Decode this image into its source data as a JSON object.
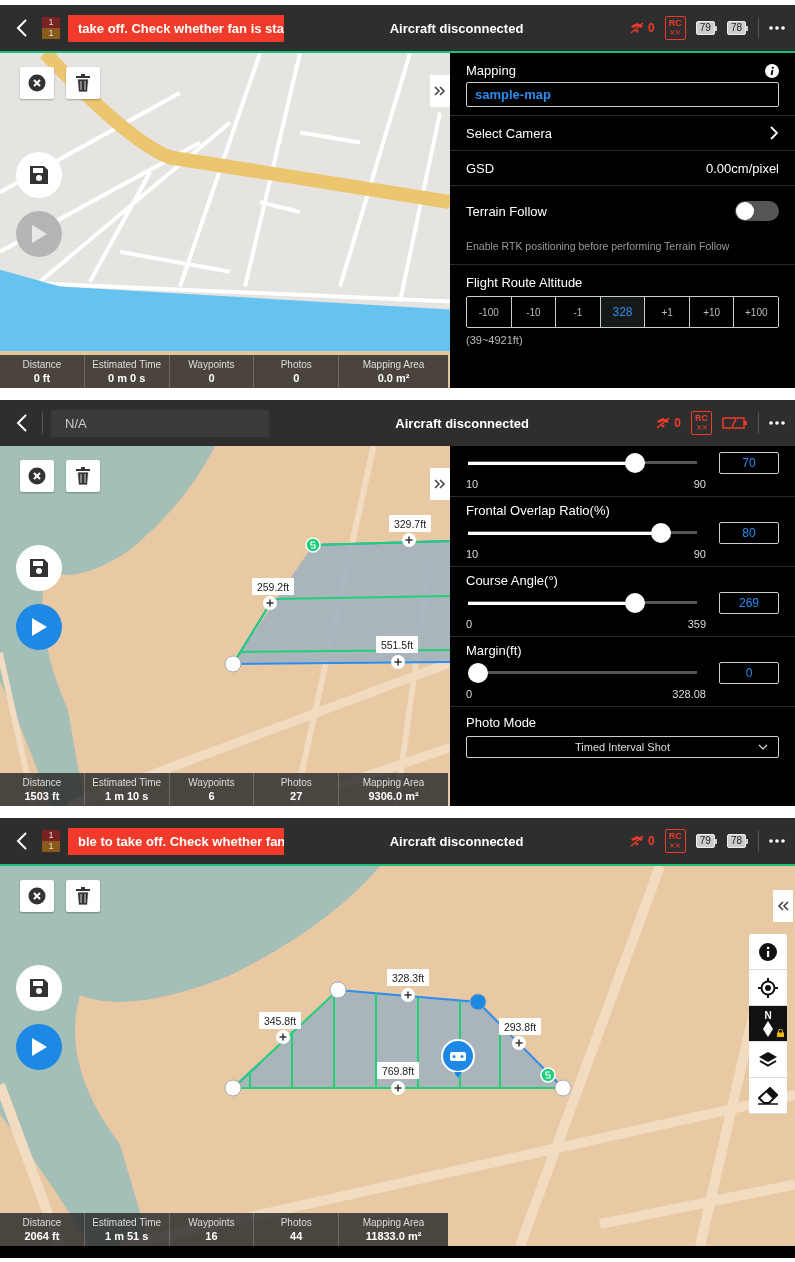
{
  "screens": [
    {
      "top_bar": {
        "alert_counts": [
          "1",
          "1"
        ],
        "alert": "take off. Check whether fan is sta",
        "title": "Aircraft disconnected",
        "signal": "0",
        "rc_label": "RC",
        "battery_low": false,
        "batteries": [
          "79",
          "78"
        ]
      },
      "map": {
        "kind": "streets",
        "play_enabled": false,
        "panel_open": true
      },
      "stats": [
        {
          "label": "Distance",
          "value": "0 ft"
        },
        {
          "label": "Estimated Time",
          "value": "0 m 0 s"
        },
        {
          "label": "Waypoints",
          "value": "0"
        },
        {
          "label": "Photos",
          "value": "0"
        },
        {
          "label": "Mapping Area",
          "value": "0.0 m²"
        }
      ],
      "panel": {
        "kind": "mission",
        "title": "Mapping",
        "name": "sample-map",
        "camera_label": "Select Camera",
        "gsd_label": "GSD",
        "gsd_value": "0.00cm/pixel",
        "terrain": {
          "label": "Terrain Follow",
          "on": false,
          "hint": "Enable RTK positioning before performing Terrain Follow"
        },
        "altitude": {
          "label": "Flight Route Altitude",
          "steps": [
            {
              "label": "-100",
              "selected": false
            },
            {
              "label": "-10",
              "selected": false
            },
            {
              "label": "-1",
              "selected": false
            },
            {
              "label": "328",
              "selected": true
            },
            {
              "label": "+1",
              "selected": false
            },
            {
              "label": "+10",
              "selected": false
            },
            {
              "label": "+100",
              "selected": false
            }
          ],
          "range": "(39~4921ft)"
        }
      }
    },
    {
      "top_bar": {
        "field": "N/A",
        "title": "Aircraft disconnected",
        "signal": "0",
        "rc_label": "RC",
        "battery_low": true
      },
      "map": {
        "kind": "terrain",
        "play_enabled": true,
        "panel_open": true,
        "route_labels": [
          "329.7ft",
          "259.2ft",
          "551.5ft"
        ]
      },
      "stats": [
        {
          "label": "Distance",
          "value": "1503 ft"
        },
        {
          "label": "Estimated Time",
          "value": "1 m 10 s"
        },
        {
          "label": "Waypoints",
          "value": "6"
        },
        {
          "label": "Photos",
          "value": "27"
        },
        {
          "label": "Mapping Area",
          "value": "9306.0 m²"
        }
      ],
      "panel": {
        "kind": "capture",
        "sliders": [
          {
            "min": "10",
            "max": "90",
            "level": 0.75,
            "value": "70"
          },
          {
            "label": "Frontal Overlap Ratio(%)",
            "min": "10",
            "max": "90",
            "level": 0.875,
            "value": "80"
          },
          {
            "label": "Course Angle(°)",
            "min": "0",
            "max": "359",
            "level": 0.75,
            "value": "269"
          },
          {
            "label": "Margin(ft)",
            "min": "0",
            "max": "328.08",
            "level": 0,
            "value": "0"
          }
        ],
        "photo_mode": {
          "label": "Photo Mode",
          "value": "Timed Interval Shot"
        }
      }
    },
    {
      "top_bar": {
        "alert_counts": [
          "1",
          "1"
        ],
        "alert": "ble to take off. Check whether fan",
        "title": "Aircraft disconnected",
        "signal": "0",
        "rc_label": "RC",
        "battery_low": false,
        "batteries": [
          "79",
          "78"
        ]
      },
      "map": {
        "kind": "terrain",
        "play_enabled": true,
        "panel_open": false,
        "route_labels": [
          "328.3ft",
          "345.8ft",
          "293.8ft",
          "769.8ft"
        ],
        "compass_label": "N"
      },
      "stats": [
        {
          "label": "Distance",
          "value": "2064 ft"
        },
        {
          "label": "Estimated Time",
          "value": "1 m 51 s"
        },
        {
          "label": "Waypoints",
          "value": "16"
        },
        {
          "label": "Photos",
          "value": "44"
        },
        {
          "label": "Mapping Area",
          "value": "11833.0 m²"
        }
      ]
    }
  ]
}
